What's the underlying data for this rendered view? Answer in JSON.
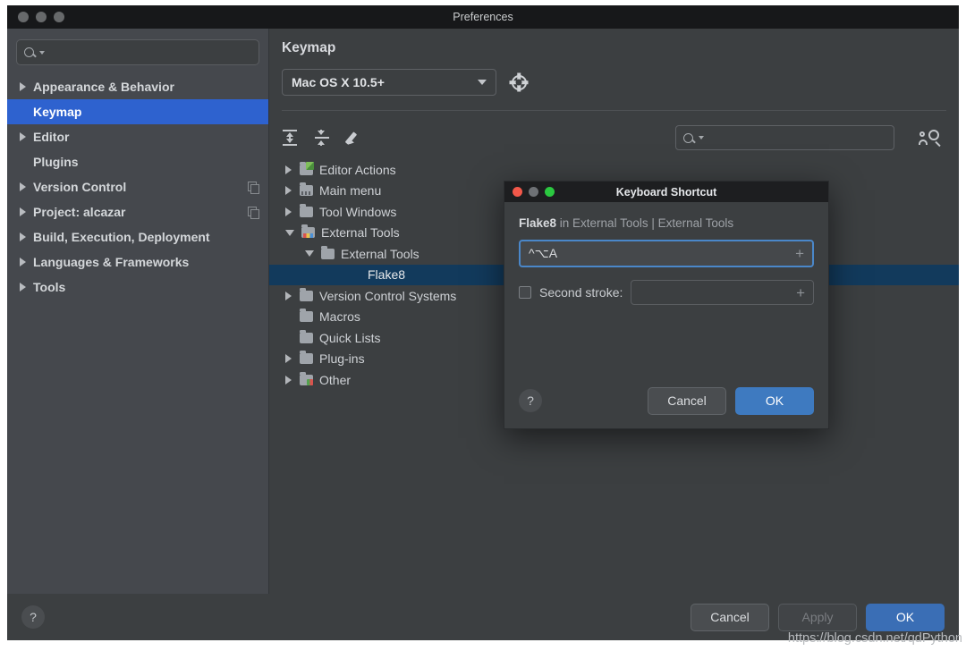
{
  "window": {
    "title": "Preferences",
    "traffic_lights": [
      "close",
      "minimize",
      "zoom"
    ]
  },
  "sidebar": {
    "search": {
      "placeholder": "",
      "value": "",
      "icon": "search-icon"
    },
    "items": [
      {
        "label": "Appearance & Behavior",
        "expandable": true,
        "selected": false,
        "badge": false
      },
      {
        "label": "Keymap",
        "expandable": false,
        "selected": true,
        "badge": false
      },
      {
        "label": "Editor",
        "expandable": true,
        "selected": false,
        "badge": false
      },
      {
        "label": "Plugins",
        "expandable": false,
        "selected": false,
        "badge": false
      },
      {
        "label": "Version Control",
        "expandable": true,
        "selected": false,
        "badge": true
      },
      {
        "label": "Project: alcazar",
        "expandable": true,
        "selected": false,
        "badge": true
      },
      {
        "label": "Build, Execution, Deployment",
        "expandable": true,
        "selected": false,
        "badge": false
      },
      {
        "label": "Languages & Frameworks",
        "expandable": true,
        "selected": false,
        "badge": false
      },
      {
        "label": "Tools",
        "expandable": true,
        "selected": false,
        "badge": false
      }
    ]
  },
  "main": {
    "title": "Keymap",
    "keymap_select": {
      "value": "Mac OS X 10.5+",
      "icon": "chevron-down-icon"
    },
    "gear_label": "gear-icon",
    "toolbar": {
      "expand_all": "expand-all-icon",
      "collapse_all": "collapse-all-icon",
      "edit": "pencil-icon"
    },
    "find": {
      "placeholder": "",
      "value": "",
      "icon": "search-icon"
    },
    "find_by_shortcut": "find-by-shortcut-icon",
    "tree": [
      {
        "label": "Editor Actions",
        "depth": 0,
        "state": "collapsed",
        "icon": "folder-green",
        "selected": false
      },
      {
        "label": "Main menu",
        "depth": 0,
        "state": "collapsed",
        "icon": "folder-menu",
        "selected": false
      },
      {
        "label": "Tool Windows",
        "depth": 0,
        "state": "collapsed",
        "icon": "folder",
        "selected": false
      },
      {
        "label": "External Tools",
        "depth": 0,
        "state": "expanded",
        "icon": "folder-ext",
        "selected": false
      },
      {
        "label": "External Tools",
        "depth": 1,
        "state": "expanded",
        "icon": "folder",
        "selected": false
      },
      {
        "label": "Flake8",
        "depth": 2,
        "state": "leaf",
        "icon": "none",
        "selected": true
      },
      {
        "label": "Version Control Systems",
        "depth": 0,
        "state": "collapsed",
        "icon": "folder",
        "selected": false
      },
      {
        "label": "Macros",
        "depth": 0,
        "state": "leaf",
        "icon": "folder",
        "selected": false
      },
      {
        "label": "Quick Lists",
        "depth": 0,
        "state": "leaf",
        "icon": "folder",
        "selected": false
      },
      {
        "label": "Plug-ins",
        "depth": 0,
        "state": "collapsed",
        "icon": "folder",
        "selected": false
      },
      {
        "label": "Other",
        "depth": 0,
        "state": "collapsed",
        "icon": "folder-tinted",
        "selected": false
      }
    ]
  },
  "bottom_bar": {
    "help": "?",
    "cancel": "Cancel",
    "apply": "Apply",
    "apply_disabled": true,
    "ok": "OK"
  },
  "dialog": {
    "title": "Keyboard Shortcut",
    "header_strong": "Flake8",
    "header_rest": " in External Tools | External Tools",
    "shortcut_value": "^⌥A",
    "shortcut_add": "+",
    "second_stroke_checked": false,
    "second_stroke_label": "Second stroke:",
    "second_stroke_value": "",
    "second_stroke_add": "+",
    "help": "?",
    "cancel": "Cancel",
    "ok": "OK"
  },
  "watermark": "https://blog.csdn.net/qdPython",
  "colors": {
    "window_bg": "#3c3f41",
    "sidebar_bg": "#45484d",
    "sidebar_selected": "#2e62cf",
    "tree_selected": "#123a5c",
    "primary_button": "#3a6eb5",
    "focus_border": "#4a87c9",
    "titlebar": "#17181a"
  }
}
